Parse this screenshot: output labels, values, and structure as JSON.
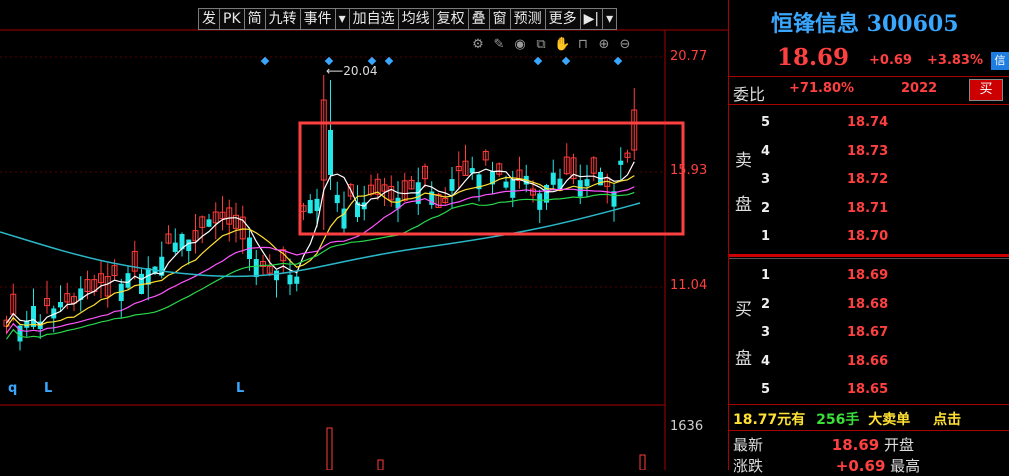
{
  "toolbar": {
    "items": [
      "发",
      "PK",
      "简",
      "九转",
      "事件",
      "▾",
      "加自选",
      "均线",
      "复权",
      "叠",
      "窗",
      "预测",
      "更多",
      "▶|",
      "▾"
    ]
  },
  "chart": {
    "price_labels": [
      "20.77",
      "15.93",
      "11.04"
    ],
    "volume_label": "1636",
    "high_marker": "20.04",
    "ma_marks": [
      "q",
      "L",
      "L"
    ],
    "colors": {
      "up": "#ff3b3b",
      "down": "#23e6e6",
      "ma5": "#ffffff",
      "ma10": "#ffe033",
      "ma20": "#ff55ff",
      "ma30": "#29d84a",
      "ma60": "#2ab8c8",
      "highlight": "#ff4040"
    }
  },
  "quote": {
    "title": "恒锋信息 300605",
    "price": "18.69",
    "change": "+0.69",
    "percent": "+3.83%",
    "badge": "信",
    "weibi_label": "委比",
    "weibi_value": "+71.80%",
    "weibi_num": "2022",
    "buy_button": "买",
    "sell_side_label": [
      "卖",
      "盘"
    ],
    "buy_side_label": [
      "买",
      "盘"
    ],
    "asks": [
      {
        "level": "5",
        "price": "18.74"
      },
      {
        "level": "4",
        "price": "18.73"
      },
      {
        "level": "3",
        "price": "18.72"
      },
      {
        "level": "2",
        "price": "18.71"
      },
      {
        "level": "1",
        "price": "18.70"
      }
    ],
    "bids": [
      {
        "level": "1",
        "price": "18.69"
      },
      {
        "level": "2",
        "price": "18.68"
      },
      {
        "level": "3",
        "price": "18.67"
      },
      {
        "level": "4",
        "price": "18.66"
      },
      {
        "level": "5",
        "price": "18.65"
      }
    ],
    "tick_price": "18.77",
    "tick_text1": "元有",
    "tick_vol": "256手",
    "tick_text2": "大卖单",
    "tick_link": "点击",
    "latest_label": "最新",
    "latest_value": "18.69",
    "open_label": "开盘",
    "change_label": "涨跌",
    "change_value": "+0.69",
    "high_label": "最高"
  }
}
